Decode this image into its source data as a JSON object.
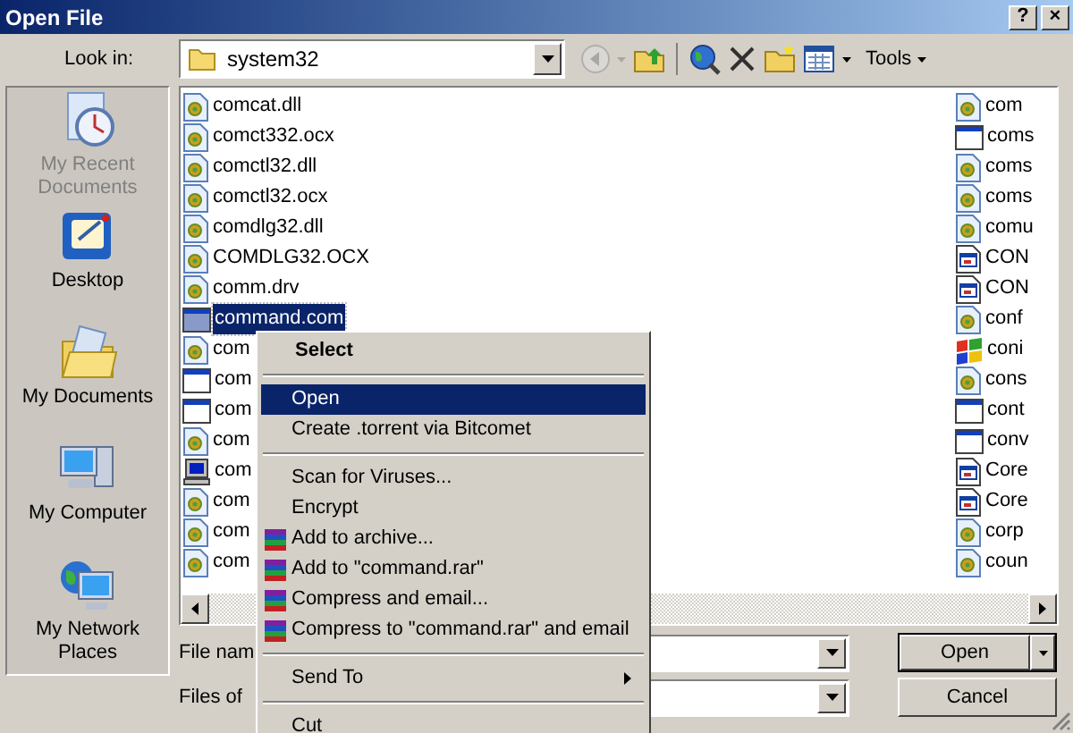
{
  "window": {
    "title": "Open File",
    "buttons": [
      "?",
      "×"
    ]
  },
  "toolbar": {
    "look_in_label": "Look in:",
    "location": "system32",
    "back_disabled": true,
    "tools_label": "Tools"
  },
  "places": [
    {
      "label": "My Recent Documents",
      "kind": "recent",
      "disabled": true
    },
    {
      "label": "Desktop",
      "kind": "desktop",
      "disabled": false
    },
    {
      "label": "My Documents",
      "kind": "documents",
      "disabled": false
    },
    {
      "label": "My Computer",
      "kind": "computer",
      "disabled": false
    },
    {
      "label": "My Network Places",
      "kind": "network",
      "disabled": false
    }
  ],
  "files": {
    "column_1": [
      {
        "name": "comcat.dll",
        "kind": "dll",
        "selected": false
      },
      {
        "name": "comct332.ocx",
        "kind": "dll",
        "selected": false
      },
      {
        "name": "comctl32.dll",
        "kind": "dll",
        "selected": false
      },
      {
        "name": "comctl32.ocx",
        "kind": "dll",
        "selected": false
      },
      {
        "name": "comdlg32.dll",
        "kind": "dll",
        "selected": false
      },
      {
        "name": "COMDLG32.OCX",
        "kind": "dll",
        "selected": false
      },
      {
        "name": "comm.drv",
        "kind": "dll",
        "selected": false
      },
      {
        "name": "command.com",
        "kind": "dos",
        "selected": true
      },
      {
        "name": "com",
        "kind": "dll",
        "selected": false
      },
      {
        "name": "com",
        "kind": "window",
        "selected": false
      },
      {
        "name": "com",
        "kind": "window",
        "selected": false
      },
      {
        "name": "com",
        "kind": "dll",
        "selected": false
      },
      {
        "name": "com",
        "kind": "computer",
        "selected": false
      },
      {
        "name": "com",
        "kind": "dll",
        "selected": false
      },
      {
        "name": "com",
        "kind": "dll",
        "selected": false
      },
      {
        "name": "com",
        "kind": "dll",
        "selected": false
      }
    ],
    "column_2": [
      {
        "name": "com",
        "kind": "dll",
        "selected": false
      },
      {
        "name": "coms",
        "kind": "window",
        "selected": false
      },
      {
        "name": "coms",
        "kind": "dll",
        "selected": false
      },
      {
        "name": "coms",
        "kind": "dll",
        "selected": false
      },
      {
        "name": "comu",
        "kind": "dll",
        "selected": false
      },
      {
        "name": "CON",
        "kind": "app",
        "selected": false
      },
      {
        "name": "CON",
        "kind": "app",
        "selected": false
      },
      {
        "name": "conf",
        "kind": "dll",
        "selected": false
      },
      {
        "name": "coni",
        "kind": "flag",
        "selected": false
      },
      {
        "name": "cons",
        "kind": "dll",
        "selected": false
      },
      {
        "name": "cont",
        "kind": "window",
        "selected": false
      },
      {
        "name": "conv",
        "kind": "window",
        "selected": false
      },
      {
        "name": "Core",
        "kind": "app",
        "selected": false
      },
      {
        "name": "Core",
        "kind": "app",
        "selected": false
      },
      {
        "name": "corp",
        "kind": "dll",
        "selected": false
      },
      {
        "name": "coun",
        "kind": "dll",
        "selected": false
      }
    ]
  },
  "file_name": {
    "label": "File nam"
  },
  "file_type": {
    "label": "Files of"
  },
  "buttons": {
    "open": "Open",
    "cancel": "Cancel"
  },
  "context_menu": [
    {
      "kind": "item",
      "label": "Select",
      "bold": true,
      "selected": false
    },
    {
      "kind": "separator"
    },
    {
      "kind": "item",
      "label": "Open",
      "selected": true
    },
    {
      "kind": "item",
      "label": "Create .torrent via Bitcomet",
      "selected": false
    },
    {
      "kind": "separator"
    },
    {
      "kind": "item",
      "label": "Scan for Viruses...",
      "selected": false
    },
    {
      "kind": "item",
      "label": "Encrypt",
      "selected": false
    },
    {
      "kind": "archive",
      "label": "Add to archive...",
      "selected": false
    },
    {
      "kind": "archive",
      "label": "Add to \"command.rar\"",
      "selected": false
    },
    {
      "kind": "archive",
      "label": "Compress and email...",
      "selected": false
    },
    {
      "kind": "archive",
      "label": "Compress to \"command.rar\" and email",
      "selected": false
    },
    {
      "kind": "separator"
    },
    {
      "kind": "item",
      "label": "Send To",
      "submenu": true,
      "selected": false
    },
    {
      "kind": "separator"
    },
    {
      "kind": "item",
      "label": "Cut",
      "selected": false
    }
  ]
}
